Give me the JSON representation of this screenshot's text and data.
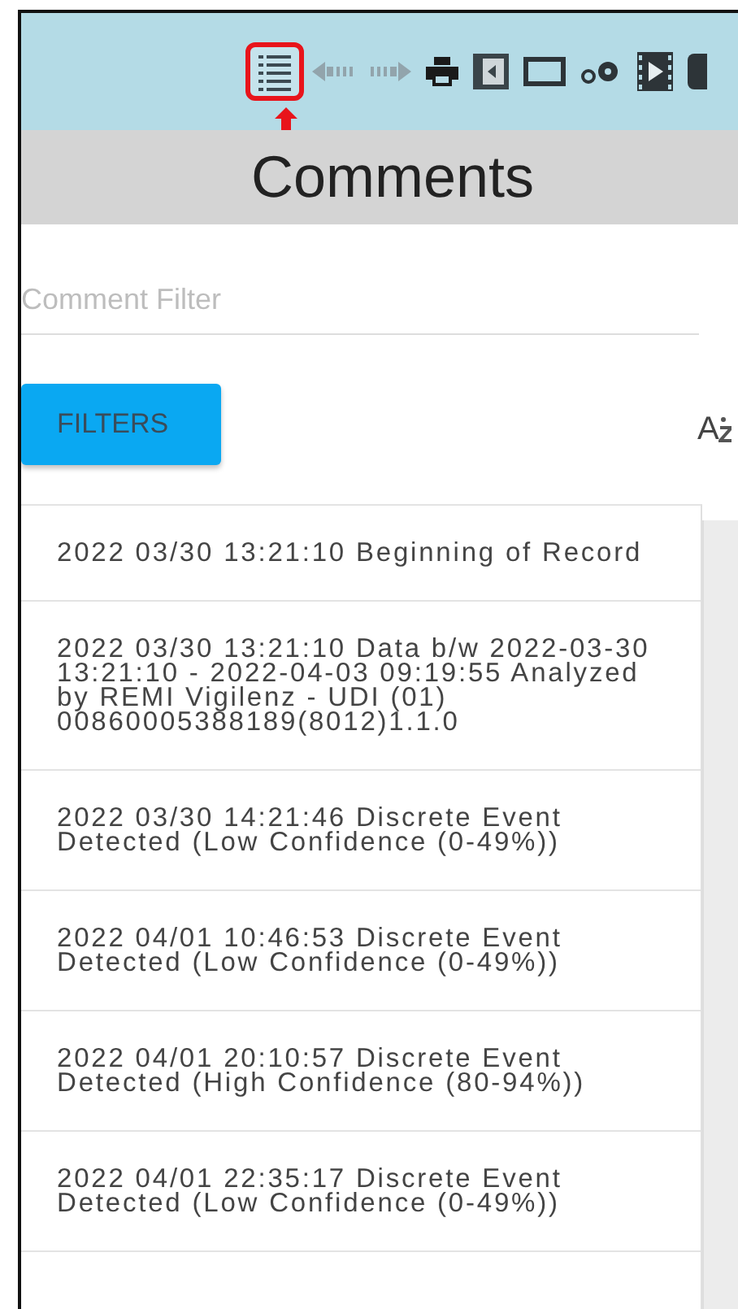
{
  "toolbar": {
    "buttons": [
      {
        "kind": "list",
        "selected": true
      },
      {
        "kind": "back",
        "disabled": true
      },
      {
        "kind": "forward",
        "disabled": true
      },
      {
        "kind": "print",
        "disabled": false
      },
      {
        "kind": "exit",
        "disabled": false
      },
      {
        "kind": "window",
        "disabled": false
      },
      {
        "kind": "settings",
        "disabled": false
      },
      {
        "kind": "video",
        "disabled": false
      },
      {
        "kind": "more",
        "disabled": false
      }
    ]
  },
  "header": {
    "title": "Comments"
  },
  "filter": {
    "placeholder": "Comment Filter"
  },
  "filters_button": "FILTERS",
  "sort_label": "A",
  "comments": [
    {
      "text": "2022 03/30 13:21:10 Beginning of Record"
    },
    {
      "text": "2022 03/30 13:21:10 Data b/w 2022-03-30 13:21:10 - 2022-04-03 09:19:55 Analyzed by REMI Vigilenz - UDI (01) 00860005388189(8012)1.1.0"
    },
    {
      "text": "2022 03/30 14:21:46 Discrete Event Detected (Low Confidence (0-49%))"
    },
    {
      "text": "2022 04/01 10:46:53 Discrete Event Detected (Low Confidence (0-49%))"
    },
    {
      "text": "2022 04/01 20:10:57 Discrete Event Detected (High Confidence (80-94%))"
    },
    {
      "text": "2022 04/01 22:35:17 Discrete Event Detected (Low Confidence (0-49%))"
    }
  ]
}
